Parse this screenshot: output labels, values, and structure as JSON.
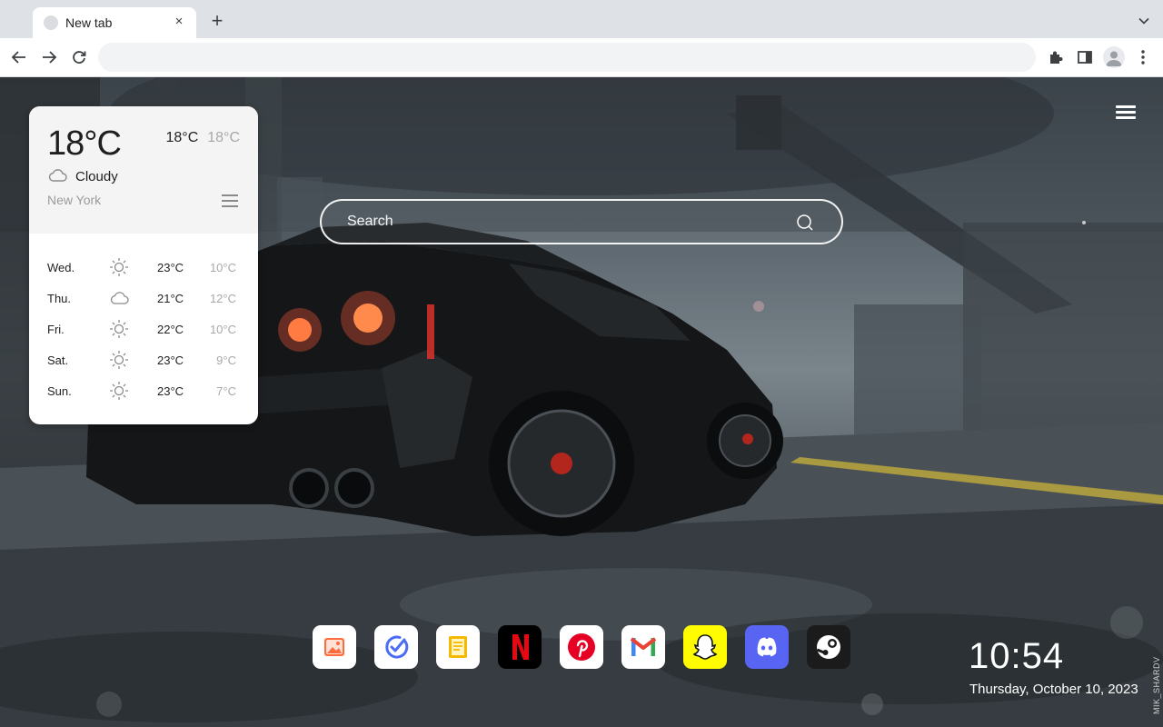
{
  "browser": {
    "tab_title": "New tab",
    "tab_close_glyph": "×",
    "new_tab_glyph": "+",
    "omnibox_value": "",
    "icons": [
      "back-icon",
      "forward-icon",
      "reload-icon",
      "extensions-icon",
      "side-panel-icon",
      "profile-icon",
      "kebab-menu-icon",
      "tab-search-icon"
    ]
  },
  "weather": {
    "temp": "18°C",
    "high": "18°C",
    "low": "18°C",
    "condition": "Cloudy",
    "city": "New York",
    "forecast": [
      {
        "day": "Wed.",
        "icon": "sun-icon",
        "high": "23°C",
        "low": "10°C"
      },
      {
        "day": "Thu.",
        "icon": "cloud-icon",
        "high": "21°C",
        "low": "12°C"
      },
      {
        "day": "Fri.",
        "icon": "sun-icon",
        "high": "22°C",
        "low": "10°C"
      },
      {
        "day": "Sat.",
        "icon": "sun-icon",
        "high": "23°C",
        "low": "9°C"
      },
      {
        "day": "Sun.",
        "icon": "sun-icon",
        "high": "23°C",
        "low": "7°C"
      }
    ]
  },
  "search": {
    "placeholder": "Search",
    "value": ""
  },
  "dock": {
    "items": [
      {
        "name": "wallpaper-app-icon",
        "color": "#ff6b3d"
      },
      {
        "name": "tasks-app-icon",
        "color": "#4a6cf7"
      },
      {
        "name": "notes-app-icon",
        "color": "#f5b800"
      },
      {
        "name": "netflix-icon",
        "color": "#e50914"
      },
      {
        "name": "pinterest-icon",
        "color": "#e60023"
      },
      {
        "name": "gmail-icon",
        "color": "#ea4335"
      },
      {
        "name": "snapchat-icon",
        "color": "#fffc00"
      },
      {
        "name": "discord-icon",
        "color": "#5865f2"
      },
      {
        "name": "steam-icon",
        "color": "#1b1b1b"
      }
    ]
  },
  "clock": {
    "time": "10:54",
    "date": "Thursday, October 10, 2023"
  },
  "credit": "MIK_SHARDV"
}
